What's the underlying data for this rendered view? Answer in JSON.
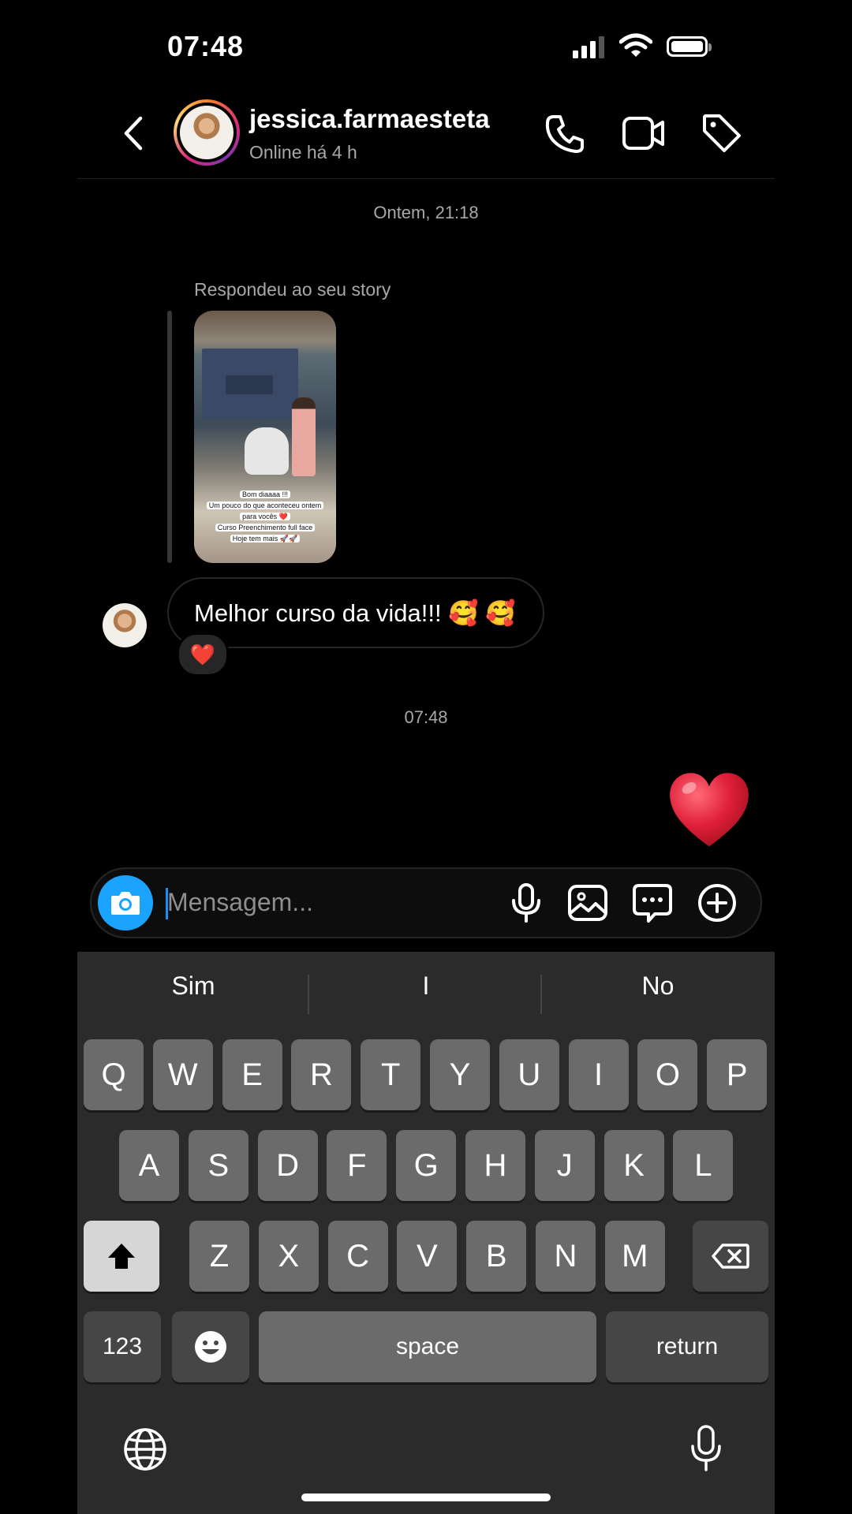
{
  "status_bar": {
    "time": "07:48"
  },
  "header": {
    "username": "jessica.farmaesteta",
    "status": "Online há 4 h",
    "icons": [
      "back-icon",
      "phone-icon",
      "video-icon",
      "tag-icon"
    ]
  },
  "thread": {
    "timestamp_1": "Ontem, 21:18",
    "reply_label": "Respondeu ao seu story",
    "story_caption": [
      "Bom diaaaa !!!",
      "Um pouco do que aconteceu ontem",
      "para vocês ❤️",
      "Curso Preenchimento full face",
      "Hoje tem mais 🚀🚀"
    ],
    "message": "Melhor curso da vida!!! 🥰 🥰",
    "reaction": "❤️",
    "timestamp_2": "07:48",
    "sent_heart": "❤️"
  },
  "composer": {
    "placeholder": "Mensagem..."
  },
  "keyboard": {
    "suggestions": [
      "Sim",
      "I",
      "No"
    ],
    "row1": [
      "Q",
      "W",
      "E",
      "R",
      "T",
      "Y",
      "U",
      "I",
      "O",
      "P"
    ],
    "row2": [
      "A",
      "S",
      "D",
      "F",
      "G",
      "H",
      "J",
      "K",
      "L"
    ],
    "row3": [
      "Z",
      "X",
      "C",
      "V",
      "B",
      "N",
      "M"
    ],
    "numbers_label": "123",
    "space_label": "space",
    "return_label": "return"
  },
  "colors": {
    "accent": "#1aa3ff",
    "heart": "#e0203a",
    "keyboard_bg": "#2b2b2b"
  }
}
